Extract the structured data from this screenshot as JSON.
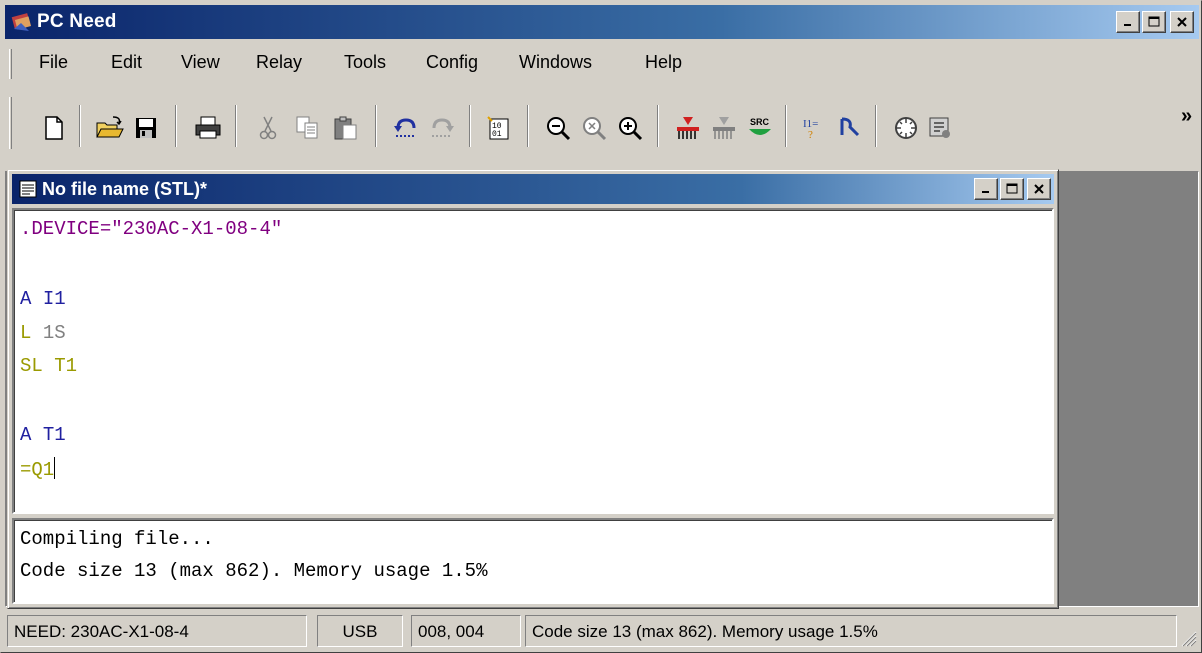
{
  "window": {
    "title": "PC Need",
    "minimize": "minimize",
    "maximize": "maximize",
    "close": "close"
  },
  "menu": {
    "items": [
      "File",
      "Edit",
      "View",
      "Relay",
      "Tools",
      "Config",
      "Windows",
      "Help"
    ]
  },
  "toolbar": {
    "buttons": [
      {
        "name": "new-file-icon"
      },
      {
        "name": "open-folder-icon"
      },
      {
        "name": "save-icon"
      },
      {
        "name": "print-icon"
      },
      {
        "name": "cut-icon"
      },
      {
        "name": "copy-icon"
      },
      {
        "name": "paste-icon"
      },
      {
        "name": "undo-icon"
      },
      {
        "name": "redo-icon"
      },
      {
        "name": "compile-icon"
      },
      {
        "name": "zoom-out-icon"
      },
      {
        "name": "zoom-reset-icon"
      },
      {
        "name": "zoom-in-icon"
      },
      {
        "name": "upload-icon"
      },
      {
        "name": "download-icon"
      },
      {
        "name": "source-icon"
      },
      {
        "name": "io-monitor-icon"
      },
      {
        "name": "relay-icon"
      },
      {
        "name": "settings-dial-icon"
      },
      {
        "name": "device-info-icon"
      }
    ],
    "overflow": "»",
    "src_label": "SRC"
  },
  "child": {
    "title": "No file name (STL)*"
  },
  "editor": {
    "lines": {
      "device": ".DEVICE=\"230AC-X1-08-4\"",
      "l1_op": "A",
      "l1_arg": "I1",
      "l2_op": "L",
      "l2_arg": "1S",
      "l3_op": "SL",
      "l3_arg": "T1",
      "l4_op": "A",
      "l4_arg": "T1",
      "l5_op": "=",
      "l5_arg": "Q1"
    }
  },
  "output": {
    "line1": "Compiling file...",
    "line2": "Code size 13 (max 862). Memory usage 1.5%"
  },
  "status": {
    "device": "NEED: 230AC-X1-08-4",
    "connection": "USB",
    "cursor": "008, 004",
    "message": "Code size 13 (max 862). Memory usage 1.5%"
  },
  "colors": {
    "titlebar_start": "#0a246a",
    "titlebar_end": "#a6caf0",
    "keyword_purple": "#800080",
    "keyword_navy": "#2020a0",
    "keyword_olive": "#9a9a00"
  }
}
